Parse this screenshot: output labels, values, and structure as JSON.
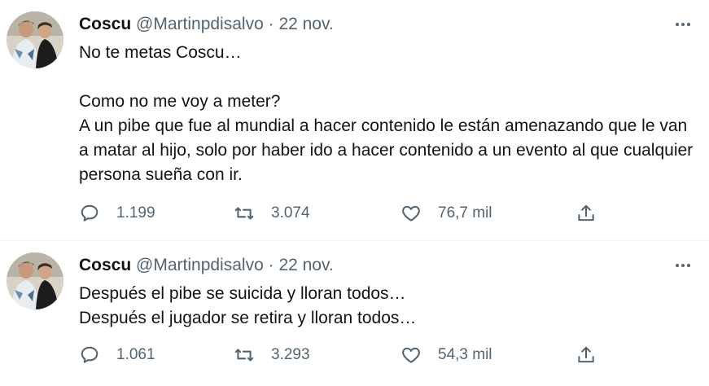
{
  "tweets": [
    {
      "author_name": "Coscu",
      "handle": "@Martinpdisalvo",
      "separator": "·",
      "date": "22 nov.",
      "text": "No te metas Coscu…\n\nComo no me voy a meter?\nA un pibe que fue al mundial a hacer contenido le están amenazando que le van a matar al hijo, solo por haber ido a hacer contenido a un evento al que cualquier persona sueña con ir.",
      "replies": "1.199",
      "retweets": "3.074",
      "likes": "76,7 mil"
    },
    {
      "author_name": "Coscu",
      "handle": "@Martinpdisalvo",
      "separator": "·",
      "date": "22 nov.",
      "text": "Después el pibe se suicida y lloran todos…\nDespués el jugador se retira y lloran todos…",
      "replies": "1.061",
      "retweets": "3.293",
      "likes": "54,3 mil"
    }
  ],
  "icons": {
    "more": "more-horizontal-icon",
    "reply": "speech-bubble-icon",
    "retweet": "retweet-arrows-icon",
    "like": "heart-icon",
    "share": "share-upload-icon"
  },
  "colors": {
    "text": "#0f1419",
    "secondary": "#536471",
    "divider": "#eff3f4"
  }
}
